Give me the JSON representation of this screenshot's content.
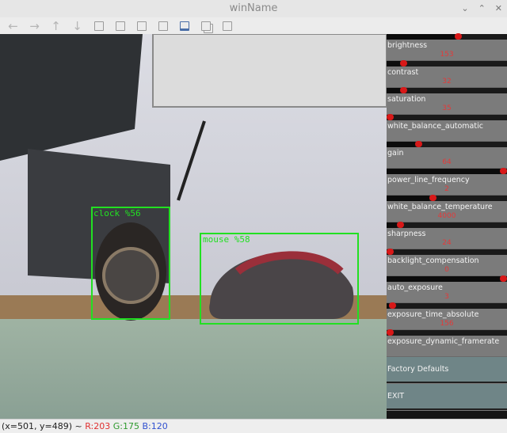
{
  "window": {
    "title": "winName",
    "controls": [
      "⌄",
      "⌃",
      "✕"
    ]
  },
  "toolbar": {
    "buttons": [
      {
        "name": "pan-left-button",
        "glyph": "←"
      },
      {
        "name": "pan-right-button",
        "glyph": "→"
      },
      {
        "name": "pan-up-button",
        "glyph": "↑"
      },
      {
        "name": "pan-down-button",
        "glyph": "↓"
      },
      {
        "name": "zoom-in-button",
        "glyph": ""
      },
      {
        "name": "zoom-original-button",
        "glyph": ""
      },
      {
        "name": "zoom-fit-button",
        "glyph": ""
      },
      {
        "name": "save-image-button",
        "glyph": ""
      },
      {
        "name": "properties-button",
        "glyph": ""
      },
      {
        "name": "copy-button",
        "glyph": ""
      },
      {
        "name": "paste-button",
        "glyph": ""
      }
    ]
  },
  "detections": [
    {
      "label": "clock %56",
      "color": "#22e022"
    },
    {
      "label": "mouse %58",
      "color": "#22e022"
    }
  ],
  "trackbars": [
    {
      "name": "brightness",
      "value": "153",
      "level": 0.6
    },
    {
      "name": "contrast",
      "value": "32",
      "level": 0.12
    },
    {
      "name": "saturation",
      "value": "35",
      "level": 0.12
    },
    {
      "name": "white_balance_automatic",
      "value": "",
      "level": 0.0
    },
    {
      "name": "gain",
      "value": "64",
      "level": 0.25
    },
    {
      "name": "power_line_frequency",
      "value": "2",
      "level": 1.0
    },
    {
      "name": "white_balance_temperature",
      "value": "4000",
      "level": 0.38
    },
    {
      "name": "sharpness",
      "value": "24",
      "level": 0.09
    },
    {
      "name": "backlight_compensation",
      "value": "0",
      "level": 0.0
    },
    {
      "name": "auto_exposure",
      "value": "3",
      "level": 1.0
    },
    {
      "name": "exposure_time_absolute",
      "value": "156",
      "level": 0.02
    },
    {
      "name": "exposure_dynamic_framerate",
      "value": "",
      "level": 0.0
    }
  ],
  "buttons": {
    "factory_defaults": "Factory Defaults",
    "exit": "EXIT"
  },
  "status": {
    "coords": "(x=501, y=489) ~ ",
    "r": "R:203",
    "g": "G:175",
    "b": "B:120",
    "r_color": "#e03030",
    "g_color": "#2e9a2e",
    "b_color": "#3050d0"
  }
}
